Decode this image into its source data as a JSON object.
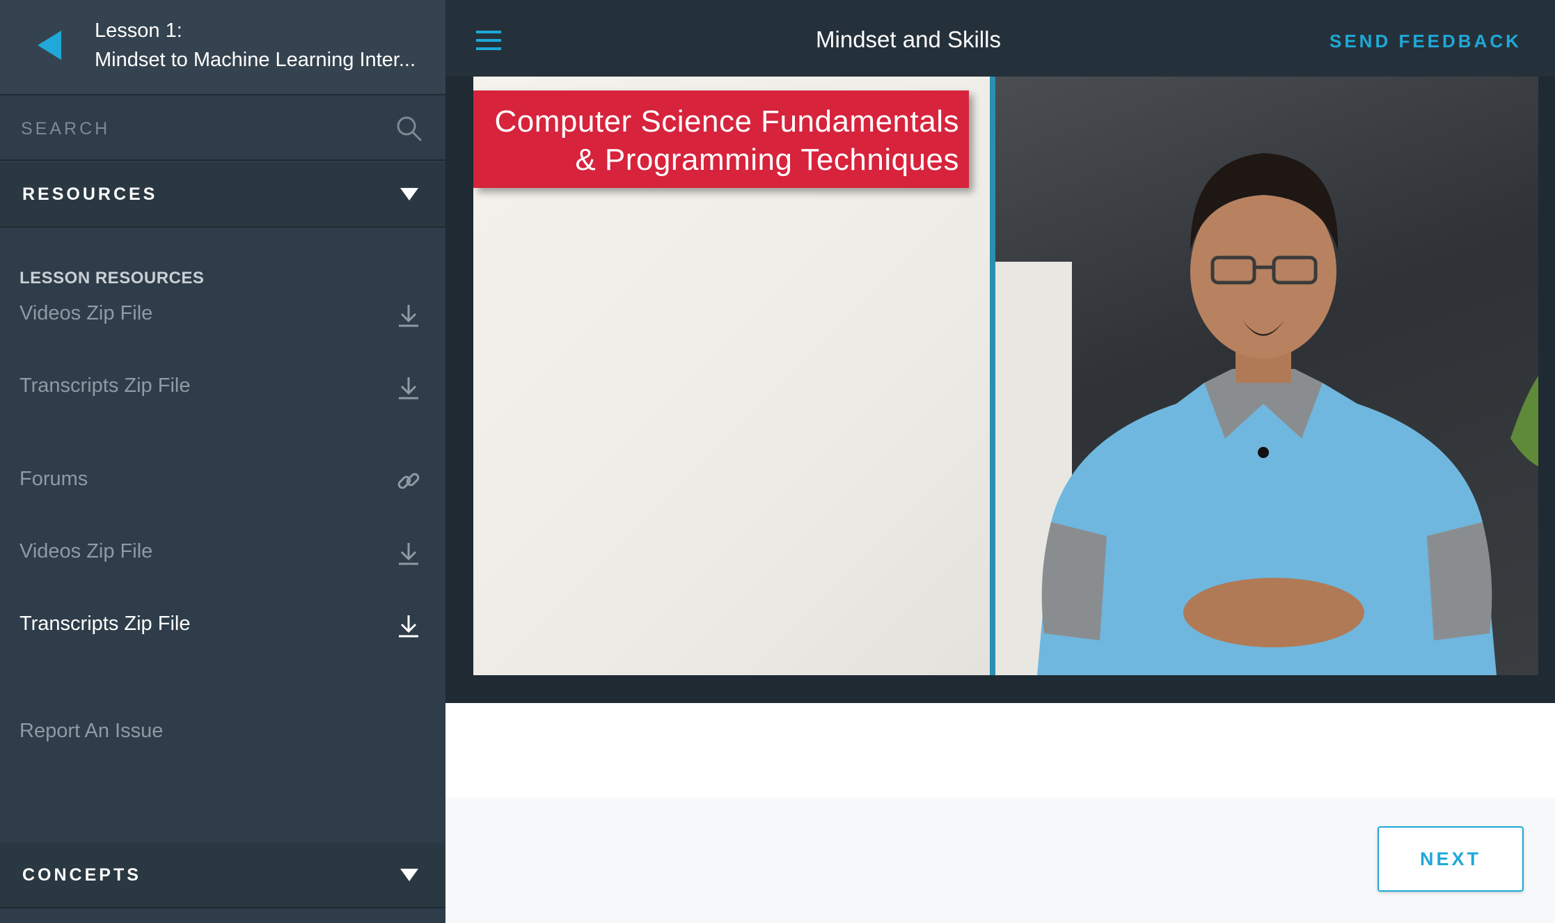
{
  "sidebar": {
    "header": {
      "lesson_number": "Lesson 1:",
      "lesson_title": "Mindset to Machine Learning Inter..."
    },
    "search": {
      "placeholder": "SEARCH"
    },
    "resources_label": "RESOURCES",
    "lesson_resources_heading": "LESSON RESOURCES",
    "items": [
      {
        "label": "Videos Zip File",
        "icon": "download-icon"
      },
      {
        "label": "Transcripts Zip File",
        "icon": "download-icon"
      },
      {
        "label": "Forums",
        "icon": "link-icon"
      },
      {
        "label": "Videos Zip File",
        "icon": "download-icon"
      },
      {
        "label": "Transcripts Zip File",
        "icon": "download-icon",
        "active": true
      },
      {
        "label": "Report An Issue"
      }
    ],
    "concepts_label": "CONCEPTS"
  },
  "topbar": {
    "title": "Mindset and Skills",
    "feedback_label": "SEND FEEDBACK"
  },
  "video": {
    "banner_line1": "Computer Science Fundamentals",
    "banner_line2": "& Programming Techniques"
  },
  "footer": {
    "next_label": "NEXT"
  },
  "colors": {
    "sidebar_bg": "#2e3d49",
    "topbar_bg": "#25313a",
    "accent": "#1fa8d8",
    "banner_red": "#d7233c"
  }
}
